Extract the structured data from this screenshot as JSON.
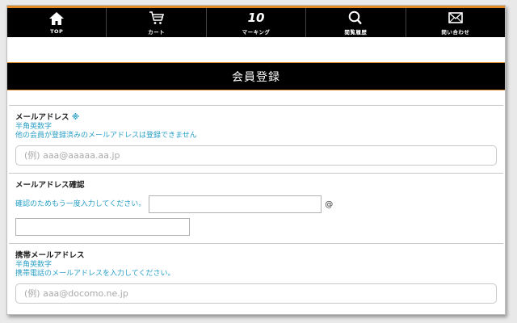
{
  "nav": {
    "items": [
      {
        "label": "TOP",
        "icon": "home-icon"
      },
      {
        "label": "カート",
        "icon": "cart-icon"
      },
      {
        "label": "マーキング",
        "icon": "number-10-icon",
        "icon_text": "10"
      },
      {
        "label": "閲覧履歴",
        "icon": "search-icon"
      },
      {
        "label": "問い合わせ",
        "icon": "mail-icon"
      }
    ]
  },
  "page": {
    "title": "会員登録"
  },
  "form": {
    "email": {
      "label": "メールアドレス",
      "required_mark": "※",
      "note1": "半角英数字",
      "note2": "他の会員が登録済みのメールアドレスは登録できません",
      "placeholder": "(例) aaa@aaaaa.aa.jp"
    },
    "email_confirm": {
      "label": "メールアドレス確認",
      "note": "確認のためもう一度入力してください。",
      "at_sign": "@"
    },
    "mobile_email": {
      "label": "携帯メールアドレス",
      "note1": "半角英数字",
      "note2": "携帯電話のメールアドレスを入力してください。",
      "placeholder": "(例) aaa@docomo.ne.jp"
    }
  },
  "colors": {
    "accent": "#e08a28",
    "note_text": "#2aa0c8",
    "nav_bg": "#000000"
  }
}
